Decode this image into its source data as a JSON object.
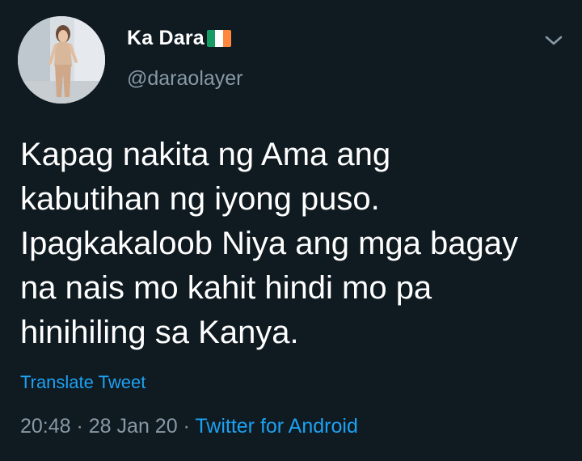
{
  "tweet": {
    "display_name": "Ka Dara",
    "handle": "@daraolayer",
    "flag_colors": [
      "#169b62",
      "#ffffff",
      "#ff883e"
    ],
    "text_lines": [
      "Kapag nakita ng Ama ang",
      "kabutihan ng iyong puso.",
      "Ipagkakaloob Niya ang mga bagay",
      "na nais mo kahit hindi mo pa",
      "hinihiling sa Kanya."
    ],
    "translate_label": "Translate Tweet",
    "time": "20:48",
    "separator": " · ",
    "date": "28 Jan 20",
    "source": "Twitter for Android"
  },
  "icons": {
    "caret": "chevron-down-icon",
    "avatar": "profile-photo"
  },
  "colors": {
    "background": "#0f1a21",
    "text": "#ffffff",
    "secondary": "#8899a6",
    "link": "#1da1f2"
  }
}
